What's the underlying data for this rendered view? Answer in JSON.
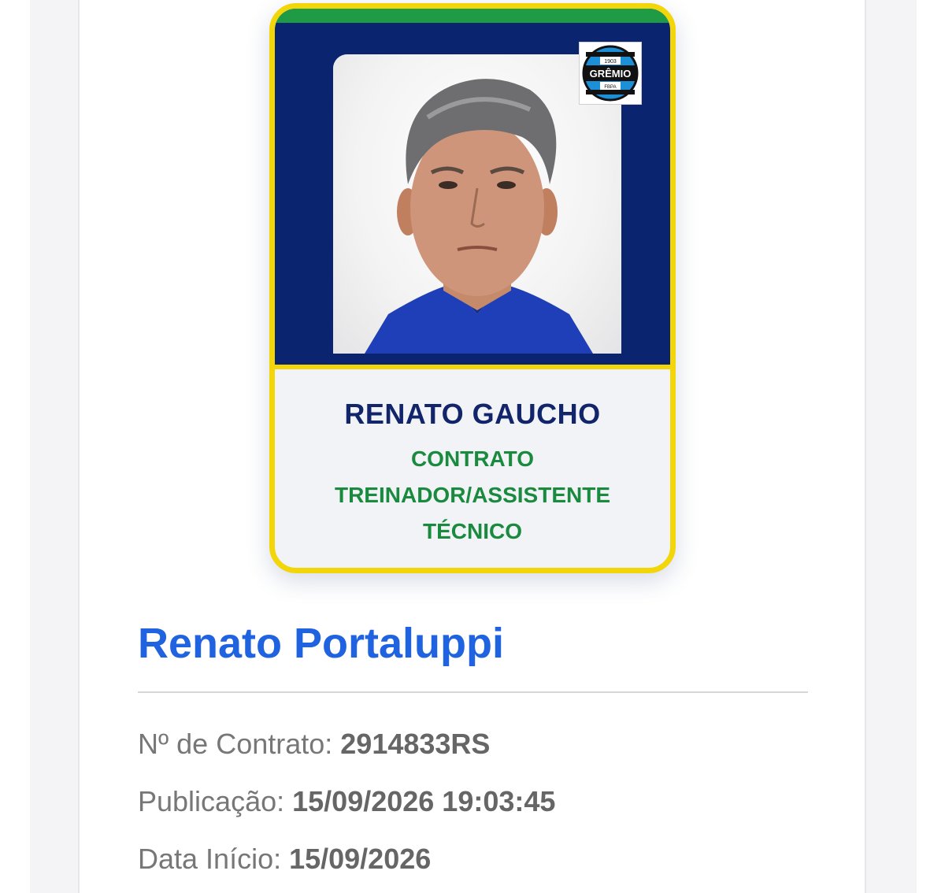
{
  "card": {
    "nickname": "RENATO GAUCHO",
    "role_lines": [
      "CONTRATO",
      "TREINADOR/ASSISTENTE",
      "TÉCNICO"
    ],
    "crest": {
      "name": "GRÊMIO",
      "year": "1903",
      "initials": "FBPA"
    },
    "colors": {
      "border": "#f2d60a",
      "top": "#0a2470",
      "stripe": "#1f9a45",
      "name": "#12246a",
      "role": "#1a8a3e"
    }
  },
  "person": {
    "full_name": "Renato Portaluppi",
    "name_color": "#1f63e0"
  },
  "details": [
    {
      "label": "Nº de Contrato: ",
      "value": "2914833RS"
    },
    {
      "label": "Publicação: ",
      "value": "15/09/2026 19:03:45"
    },
    {
      "label": "Data Início: ",
      "value": "15/09/2026"
    }
  ]
}
